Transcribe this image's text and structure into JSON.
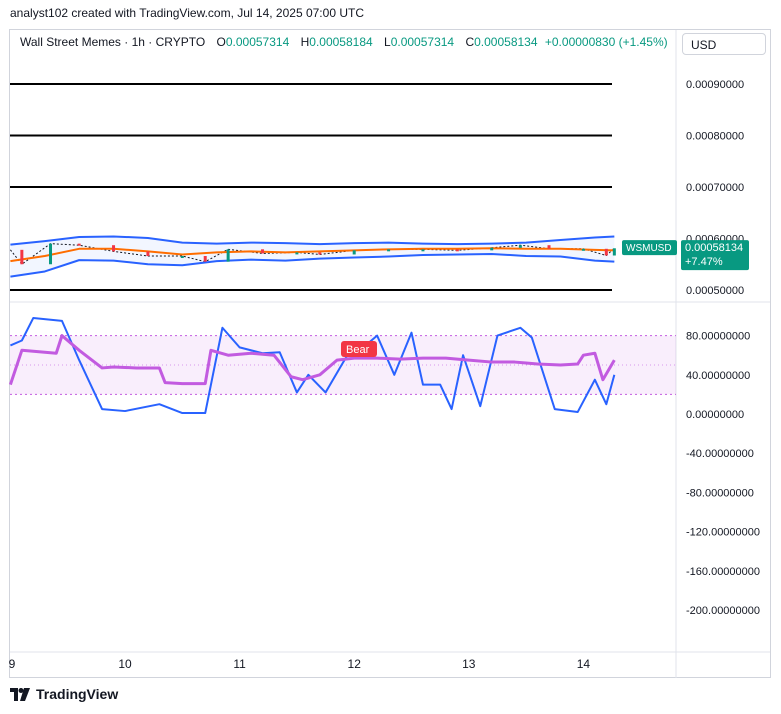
{
  "attribution": "analyst102 created with TradingView.com, Jul 14, 2025 07:00 UTC",
  "legend": {
    "symbol_line": "Wall Street Memes · 1h · CRYPTO",
    "o_label": "O",
    "o_value": "0.00057314",
    "h_label": "H",
    "h_value": "0.00058184",
    "l_label": "L",
    "l_value": "0.00057314",
    "c_label": "C",
    "c_value": "0.00058134",
    "change": "+0.00000830 (+1.45%)"
  },
  "currency_button": "USD",
  "price_tag": {
    "symbol": "WSMUSD",
    "price": "0.00058134",
    "change": "+7.47%"
  },
  "bear_label": "Bear",
  "logo_text": "TradingView",
  "colors": {
    "upper_band": "#2962ff",
    "lower_band": "#2962ff",
    "basis": "#ff6d00",
    "stoch_k": "#2962ff",
    "stoch_d": "#c25be0",
    "up": "#089981",
    "down": "#f23645",
    "bear": "#f23645"
  },
  "chart_data": [
    {
      "type": "line",
      "panel": "price",
      "y_ticks": [
        "0.00090000",
        "0.00080000",
        "0.00070000",
        "0.00060000",
        "0.00050000"
      ],
      "ylim": [
        0.00045,
        0.00093
      ],
      "x_ticks": [
        "9",
        "10",
        "11",
        "12",
        "13",
        "14"
      ],
      "horizontal_levels": [
        0.0009,
        0.0008,
        0.0007,
        0.0005
      ],
      "series": [
        {
          "role": "upper_band",
          "x": [
            9.0,
            9.3,
            9.6,
            9.9,
            10.2,
            10.5,
            10.8,
            11.1,
            11.4,
            11.7,
            12.0,
            12.3,
            12.6,
            12.9,
            13.2,
            13.5,
            13.8,
            14.1,
            14.27
          ],
          "values": [
            0.000588,
            0.000595,
            0.000603,
            0.000604,
            0.000601,
            0.000592,
            0.00059,
            0.000592,
            0.000591,
            0.000589,
            0.000591,
            0.000592,
            0.00059,
            0.000589,
            0.00059,
            0.000592,
            0.000597,
            0.000602,
            0.000604
          ]
        },
        {
          "role": "basis",
          "x": [
            9.0,
            9.3,
            9.6,
            9.9,
            10.2,
            10.5,
            10.8,
            11.1,
            11.4,
            11.7,
            12.0,
            12.3,
            12.6,
            12.9,
            13.2,
            13.5,
            13.8,
            14.1,
            14.27
          ],
          "values": [
            0.000556,
            0.000566,
            0.00058,
            0.00058,
            0.000575,
            0.000569,
            0.000573,
            0.000575,
            0.000573,
            0.000575,
            0.000577,
            0.000579,
            0.00058,
            0.00058,
            0.000581,
            0.00058,
            0.00058,
            0.000578,
            0.000577
          ]
        },
        {
          "role": "lower_band",
          "x": [
            9.0,
            9.3,
            9.6,
            9.9,
            10.2,
            10.5,
            10.8,
            11.1,
            11.4,
            11.7,
            12.0,
            12.3,
            12.6,
            12.9,
            13.2,
            13.5,
            13.8,
            14.1,
            14.27
          ],
          "values": [
            0.000526,
            0.000536,
            0.000558,
            0.000557,
            0.00055,
            0.000548,
            0.000556,
            0.000559,
            0.000557,
            0.000561,
            0.000563,
            0.000565,
            0.000568,
            0.000569,
            0.00057,
            0.000566,
            0.000565,
            0.000557,
            0.000555
          ]
        },
        {
          "role": "close",
          "x": [
            9.0,
            9.1,
            9.35,
            9.6,
            9.9,
            10.2,
            10.5,
            10.7,
            10.9,
            11.2,
            11.5,
            11.7,
            12.0,
            12.3,
            12.6,
            12.9,
            13.2,
            13.45,
            13.7,
            14.0,
            14.2,
            14.27
          ],
          "values": [
            0.000578,
            0.00055,
            0.00059,
            0.000587,
            0.000575,
            0.000566,
            0.000566,
            0.000555,
            0.000579,
            0.000571,
            0.000573,
            0.000569,
            0.000577,
            0.000579,
            0.000579,
            0.000577,
            0.000582,
            0.000587,
            0.00058,
            0.00058,
            0.000567,
            0.000581
          ]
        }
      ]
    },
    {
      "type": "line",
      "panel": "stochastic_rsi",
      "y_ticks": [
        "80.00000000",
        "40.00000000",
        "0.00000000",
        "-40.00000000",
        "-80.00000000",
        "-120.00000000",
        "-160.00000000",
        "-200.00000000"
      ],
      "ylim": [
        -240,
        105
      ],
      "bands": [
        80,
        20
      ],
      "series": [
        {
          "role": "stoch_k",
          "x": [
            9.0,
            9.1,
            9.2,
            9.45,
            9.6,
            9.8,
            10.0,
            10.3,
            10.5,
            10.7,
            10.85,
            11.0,
            11.2,
            11.35,
            11.5,
            11.6,
            11.75,
            11.95,
            12.05,
            12.2,
            12.35,
            12.5,
            12.6,
            12.75,
            12.85,
            12.95,
            13.1,
            13.25,
            13.45,
            13.55,
            13.75,
            13.95,
            14.1,
            14.2,
            14.27
          ],
          "values": [
            70,
            75,
            98,
            95,
            55,
            5,
            3,
            10,
            1,
            1,
            88,
            68,
            62,
            63,
            22,
            40,
            22,
            62,
            65,
            80,
            40,
            83,
            30,
            30,
            5,
            60,
            8,
            80,
            88,
            78,
            5,
            2,
            35,
            10,
            40
          ]
        },
        {
          "role": "stoch_d",
          "x": [
            9.0,
            9.1,
            9.4,
            9.45,
            9.6,
            9.8,
            9.9,
            10.1,
            10.3,
            10.35,
            10.5,
            10.7,
            10.75,
            10.9,
            11.1,
            11.3,
            11.45,
            11.55,
            11.7,
            11.85,
            12.0,
            12.2,
            12.4,
            12.6,
            12.8,
            13.0,
            13.2,
            13.4,
            13.5,
            13.6,
            13.8,
            13.95,
            14.0,
            14.1,
            14.17,
            14.27
          ],
          "values": [
            30,
            65,
            62,
            80,
            65,
            47,
            48,
            47,
            47,
            32,
            31,
            31,
            65,
            60,
            62,
            60,
            38,
            35,
            40,
            55,
            57,
            57,
            56,
            57,
            57,
            55,
            53,
            53,
            52,
            51,
            50,
            51,
            60,
            62,
            35,
            55
          ]
        }
      ]
    }
  ]
}
